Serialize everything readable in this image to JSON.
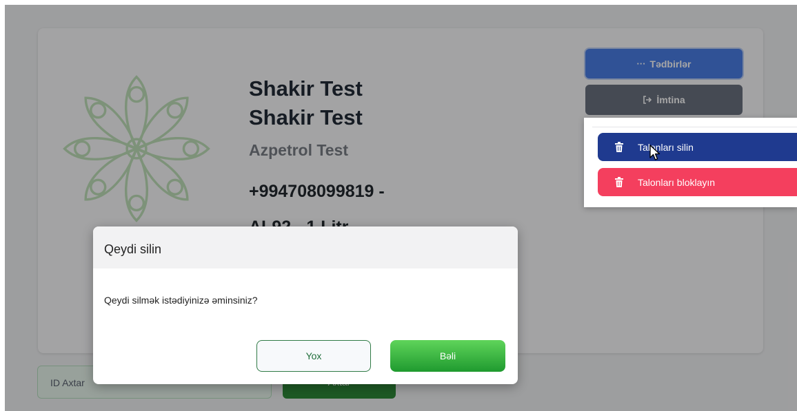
{
  "profile": {
    "name_line1": "Shakir Test",
    "name_line2": "Shakir Test",
    "company": "Azpetrol Test",
    "phone": "+994708099819 -",
    "fuel": "AI-92 - 1 Litr"
  },
  "actions": {
    "events_label": "Tədbirlər",
    "events_icon": "ellipsis-icon",
    "cancel_label": "İmtina",
    "cancel_icon": "sign-out-icon"
  },
  "dropdown": {
    "items": [
      {
        "label": "Talonları silin",
        "icon": "trash-icon",
        "color": "#1f3a8f"
      },
      {
        "label": "Talonları bloklayın",
        "icon": "trash-icon",
        "color": "#f43f5e"
      }
    ]
  },
  "search": {
    "id_placeholder": "ID Axtar",
    "button_label": "Axtar"
  },
  "modal": {
    "title": "Qeydi silin",
    "body": "Qeydi silmək istədiyinizə əminsiniz?",
    "no_label": "Yox",
    "yes_label": "Bəli"
  },
  "colors": {
    "primary": "#4b7fe6",
    "secondary": "#6b7280",
    "success": "#2e8b3a",
    "danger": "#f43f5e",
    "dark_blue": "#1f3a8f"
  }
}
